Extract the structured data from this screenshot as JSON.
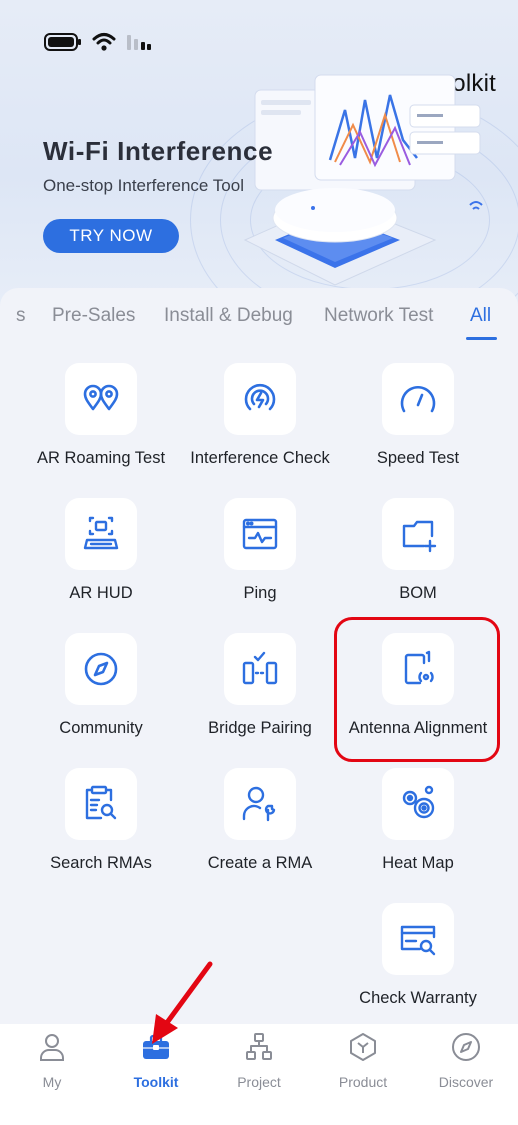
{
  "header": {
    "title": "Toolkit"
  },
  "banner": {
    "title": "Wi-Fi Interference",
    "subtitle": "One-stop Interference Tool",
    "cta_label": "TRY NOW"
  },
  "tabs": [
    {
      "label": "s",
      "active": false
    },
    {
      "label": "Pre-Sales",
      "active": false
    },
    {
      "label": "Install & Debug",
      "active": false
    },
    {
      "label": "Network Test",
      "active": false
    },
    {
      "label": "All",
      "active": true
    }
  ],
  "tools": [
    {
      "label": "AR Roaming Test",
      "icon": "map-pins-icon"
    },
    {
      "label": "Interference Check",
      "icon": "interference-icon"
    },
    {
      "label": "Speed Test",
      "icon": "speedometer-icon"
    },
    {
      "label": "AR HUD",
      "icon": "ar-scan-icon"
    },
    {
      "label": "Ping",
      "icon": "ping-window-icon"
    },
    {
      "label": "BOM",
      "icon": "folder-plus-icon"
    },
    {
      "label": "Community",
      "icon": "compass-icon"
    },
    {
      "label": "Bridge Pairing",
      "icon": "bridge-pairing-icon"
    },
    {
      "label": "Antenna Alignment",
      "icon": "antenna-alignment-icon"
    },
    {
      "label": "Search RMAs",
      "icon": "search-document-icon"
    },
    {
      "label": "Create a RMA",
      "icon": "user-wrench-icon"
    },
    {
      "label": "Heat Map",
      "icon": "heat-map-icon"
    },
    {
      "label": "Check Warranty",
      "icon": "warranty-card-icon"
    }
  ],
  "bottom_nav": [
    {
      "label": "My",
      "icon": "person-icon",
      "active": false
    },
    {
      "label": "Toolkit",
      "icon": "toolbox-icon",
      "active": true
    },
    {
      "label": "Project",
      "icon": "project-tree-icon",
      "active": false
    },
    {
      "label": "Product",
      "icon": "hexagon-icon",
      "active": false
    },
    {
      "label": "Discover",
      "icon": "compass-icon",
      "active": false
    }
  ],
  "colors": {
    "accent": "#2d6fe0",
    "highlight": "#e30613",
    "background": "#f1f3f9"
  }
}
